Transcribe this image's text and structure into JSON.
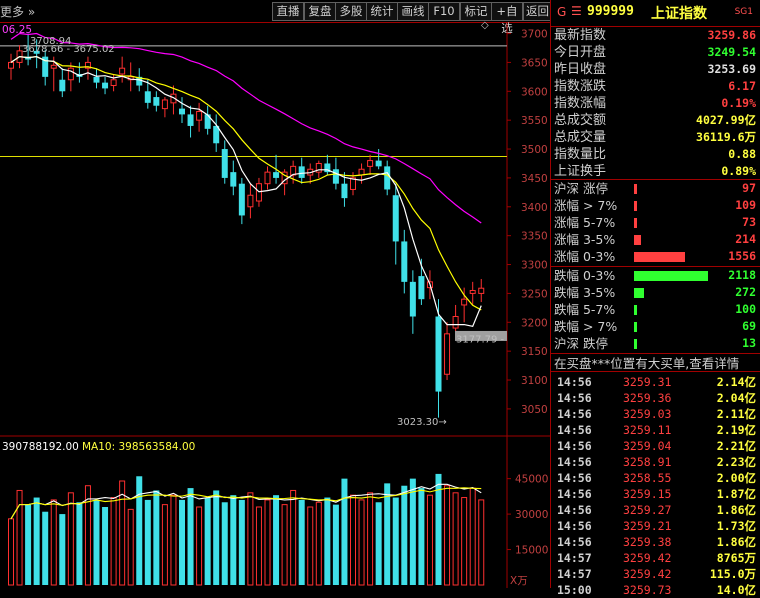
{
  "toolbar": {
    "more_label": "更多",
    "buttons": [
      "直播",
      "复盘",
      "多股",
      "统计",
      "画线",
      "F10",
      "标记",
      "+自选",
      "返回"
    ]
  },
  "main_chart": {
    "ma_label": "06.25",
    "marker_top": "3708.94",
    "marker_top2": "3678.66",
    "marker_top3": "3675.02",
    "high_line_price": 3678.66,
    "hline_price": 3487,
    "low_annotation": "3023.30",
    "current_tag": "3177.79",
    "y_labels": [
      "3700",
      "3650",
      "3600",
      "3550",
      "3500",
      "3450",
      "3400",
      "3350",
      "3300",
      "3250",
      "3200",
      "3150",
      "3100",
      "3050"
    ],
    "colors": {
      "up": "#ff3030",
      "down": "#40e0e8",
      "ma5": "#ffffff",
      "ma10": "#ffff00",
      "ma20": "#ff00ff",
      "ma60": "#b000b0"
    }
  },
  "volume_chart": {
    "label1": "390788192.00",
    "label2": "MA10: 398563584.00",
    "y_labels": [
      "45000",
      "30000",
      "15000"
    ],
    "unit": "X万"
  },
  "chart_data": {
    "type": "candlestick",
    "y_range": [
      3010,
      3720
    ],
    "candles": [
      [
        3640,
        3665,
        3620,
        3650
      ],
      [
        3650,
        3680,
        3640,
        3670
      ],
      [
        3660,
        3700,
        3645,
        3655
      ],
      [
        3670,
        3690,
        3640,
        3665
      ],
      [
        3660,
        3672,
        3610,
        3625
      ],
      [
        3640,
        3660,
        3600,
        3645
      ],
      [
        3620,
        3640,
        3590,
        3600
      ],
      [
        3620,
        3650,
        3600,
        3640
      ],
      [
        3630,
        3650,
        3615,
        3625
      ],
      [
        3640,
        3660,
        3620,
        3650
      ],
      [
        3625,
        3640,
        3605,
        3615
      ],
      [
        3615,
        3625,
        3595,
        3605
      ],
      [
        3610,
        3630,
        3600,
        3620
      ],
      [
        3630,
        3660,
        3615,
        3640
      ],
      [
        3620,
        3650,
        3600,
        3625
      ],
      [
        3625,
        3640,
        3600,
        3610
      ],
      [
        3600,
        3620,
        3570,
        3580
      ],
      [
        3590,
        3600,
        3565,
        3575
      ],
      [
        3570,
        3590,
        3555,
        3585
      ],
      [
        3580,
        3610,
        3560,
        3595
      ],
      [
        3570,
        3590,
        3545,
        3560
      ],
      [
        3560,
        3575,
        3520,
        3540
      ],
      [
        3550,
        3580,
        3530,
        3565
      ],
      [
        3560,
        3575,
        3525,
        3535
      ],
      [
        3540,
        3560,
        3495,
        3510
      ],
      [
        3500,
        3515,
        3440,
        3450
      ],
      [
        3460,
        3480,
        3420,
        3435
      ],
      [
        3440,
        3450,
        3370,
        3385
      ],
      [
        3400,
        3440,
        3380,
        3420
      ],
      [
        3410,
        3450,
        3400,
        3440
      ],
      [
        3440,
        3470,
        3430,
        3460
      ],
      [
        3460,
        3490,
        3440,
        3450
      ],
      [
        3440,
        3465,
        3420,
        3460
      ],
      [
        3455,
        3480,
        3440,
        3470
      ],
      [
        3470,
        3485,
        3440,
        3450
      ],
      [
        3455,
        3475,
        3440,
        3465
      ],
      [
        3460,
        3480,
        3450,
        3475
      ],
      [
        3475,
        3490,
        3455,
        3460
      ],
      [
        3465,
        3485,
        3430,
        3440
      ],
      [
        3440,
        3460,
        3400,
        3415
      ],
      [
        3430,
        3460,
        3420,
        3450
      ],
      [
        3455,
        3475,
        3440,
        3465
      ],
      [
        3470,
        3490,
        3455,
        3480
      ],
      [
        3480,
        3500,
        3465,
        3470
      ],
      [
        3470,
        3480,
        3420,
        3430
      ],
      [
        3420,
        3440,
        3300,
        3340
      ],
      [
        3340,
        3360,
        3250,
        3270
      ],
      [
        3270,
        3290,
        3180,
        3210
      ],
      [
        3280,
        3310,
        3230,
        3240
      ],
      [
        3260,
        3290,
        3240,
        3270
      ],
      [
        3210,
        3240,
        3035,
        3080
      ],
      [
        3110,
        3200,
        3100,
        3180
      ],
      [
        3190,
        3230,
        3180,
        3210
      ],
      [
        3230,
        3260,
        3200,
        3240
      ],
      [
        3250,
        3270,
        3230,
        3255
      ],
      [
        3250,
        3275,
        3235,
        3259
      ]
    ],
    "volume": [
      28000,
      40000,
      34000,
      37000,
      31000,
      36000,
      30000,
      39000,
      35000,
      42000,
      36000,
      33000,
      37000,
      44000,
      32000,
      46000,
      36000,
      40000,
      34000,
      38000,
      36000,
      41000,
      33000,
      37000,
      40000,
      35000,
      38000,
      36000,
      39000,
      33000,
      36000,
      38000,
      34000,
      40000,
      36000,
      33000,
      35000,
      37000,
      34000,
      45000,
      38000,
      36000,
      39000,
      35000,
      43000,
      37000,
      42000,
      45000,
      41000,
      38000,
      47000,
      42000,
      39000,
      37000,
      41000,
      36000
    ],
    "volume_range": [
      0,
      55000
    ]
  },
  "index_panel": {
    "g": "G",
    "menu": "☰",
    "code": "999999",
    "name": "上证指数",
    "sg": "SG1",
    "quotes": [
      {
        "label": "最新指数",
        "value": "3259.86",
        "color": "#ff4040"
      },
      {
        "label": "今日开盘",
        "value": "3249.54",
        "color": "#30ff30"
      },
      {
        "label": "昨日收盘",
        "value": "3253.69",
        "color": "#e0e0e0"
      },
      {
        "label": "指数涨跌",
        "value": "6.17",
        "color": "#ff4040"
      },
      {
        "label": "指数涨幅",
        "value": "0.19%",
        "color": "#ff4040"
      },
      {
        "label": "总成交额",
        "value": "4027.99亿",
        "color": "#ffff40"
      },
      {
        "label": "总成交量",
        "value": "36119.6万",
        "color": "#ffff40"
      },
      {
        "label": "指数量比",
        "value": "0.88",
        "color": "#ffff40"
      },
      {
        "label": "上证换手",
        "value": "0.89%",
        "color": "#ffff40"
      }
    ],
    "breadth_up": [
      {
        "label": "沪深 涨停",
        "value": "97",
        "bar": 0.02
      },
      {
        "label": "涨幅 > 7%",
        "value": "109",
        "bar": 0.03
      },
      {
        "label": "涨幅 5-7%",
        "value": "73",
        "bar": 0.02
      },
      {
        "label": "涨幅 3-5%",
        "value": "214",
        "bar": 0.09
      },
      {
        "label": "涨幅 0-3%",
        "value": "1556",
        "bar": 0.64
      }
    ],
    "breadth_down": [
      {
        "label": "跌幅 0-3%",
        "value": "2118",
        "bar": 0.93
      },
      {
        "label": "跌幅 3-5%",
        "value": "272",
        "bar": 0.12
      },
      {
        "label": "跌幅 5-7%",
        "value": "100",
        "bar": 0.04
      },
      {
        "label": "跌幅 > 7%",
        "value": "69",
        "bar": 0.03
      },
      {
        "label": "沪深 跌停",
        "value": "13",
        "bar": 0.01
      }
    ],
    "notice": "在买盘***位置有大买单,查看详情",
    "ticks": [
      {
        "time": "14:56",
        "price": "3259.31",
        "vol": "2.14亿"
      },
      {
        "time": "14:56",
        "price": "3259.36",
        "vol": "2.04亿"
      },
      {
        "time": "14:56",
        "price": "3259.03",
        "vol": "2.11亿"
      },
      {
        "time": "14:56",
        "price": "3259.11",
        "vol": "2.19亿"
      },
      {
        "time": "14:56",
        "price": "3259.04",
        "vol": "2.21亿"
      },
      {
        "time": "14:56",
        "price": "3258.91",
        "vol": "2.23亿"
      },
      {
        "time": "14:56",
        "price": "3258.55",
        "vol": "2.00亿"
      },
      {
        "time": "14:56",
        "price": "3259.15",
        "vol": "1.87亿"
      },
      {
        "time": "14:56",
        "price": "3259.27",
        "vol": "1.86亿"
      },
      {
        "time": "14:56",
        "price": "3259.21",
        "vol": "1.73亿"
      },
      {
        "time": "14:56",
        "price": "3259.38",
        "vol": "1.86亿"
      },
      {
        "time": "14:57",
        "price": "3259.42",
        "vol": "8765万"
      },
      {
        "time": "14:57",
        "price": "3259.42",
        "vol": "115.0万"
      },
      {
        "time": "15:00",
        "price": "3259.73",
        "vol": "14.0亿"
      }
    ]
  }
}
